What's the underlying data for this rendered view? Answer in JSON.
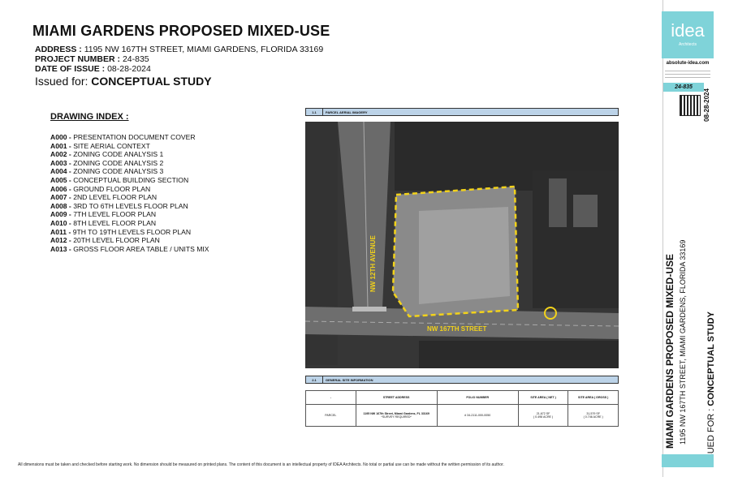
{
  "header": {
    "title": "MIAMI GARDENS PROPOSED MIXED-USE",
    "address_label": "ADDRESS :",
    "address": "1195 NW 167TH STREET, MIAMI GARDENS, FLORIDA 33169",
    "project_label": "PROJECT NUMBER :",
    "project": "24-835",
    "date_label": "DATE OF ISSUE :",
    "date": "08-28-2024",
    "issued_label": "Issued for:",
    "issued": "CONCEPTUAL STUDY"
  },
  "index": {
    "heading": "DRAWING INDEX :",
    "items": [
      {
        "code": "A000 -",
        "name": "PRESENTATION DOCUMENT COVER"
      },
      {
        "code": "A001 -",
        "name": "SITE AERIAL CONTEXT"
      },
      {
        "code": "A002 -",
        "name": "ZONING CODE ANALYSIS 1"
      },
      {
        "code": "A003 -",
        "name": "ZONING CODE ANALYSIS 2"
      },
      {
        "code": "A004 -",
        "name": "ZONING CODE ANALYSIS 3"
      },
      {
        "code": "A005 -",
        "name": "CONCEPTUAL BUILDING SECTION"
      },
      {
        "code": "A006 -",
        "name": "GROUND FLOOR PLAN"
      },
      {
        "code": "A007 -",
        "name": "2ND LEVEL FLOOR PLAN"
      },
      {
        "code": "A008 -",
        "name": "3RD TO 6TH LEVELS FLOOR PLAN"
      },
      {
        "code": "A009 -",
        "name": "7TH LEVEL FLOOR PLAN"
      },
      {
        "code": "A010 -",
        "name": "8TH LEVEL FLOOR PLAN"
      },
      {
        "code": "A011 -",
        "name": "9TH TO 19TH LEVELS FLOOR PLAN"
      },
      {
        "code": "A012 -",
        "name": "20TH LEVEL FLOOR PLAN"
      },
      {
        "code": "A013 -",
        "name": "GROSS FLOOR AREA TABLE / UNITS MIX"
      }
    ]
  },
  "aerial": {
    "bar_num": "1.1",
    "bar_title": "PARCEL AERIAL IMAGERY",
    "street_v": "NW 12TH AVENUE",
    "street_h": "NW 167TH STREET"
  },
  "siteinfo": {
    "bar_num": "2.1",
    "bar_title": "GENERAL SITE INFORMATION",
    "headers": [
      "-",
      "STREET ADDRESS",
      "FOLIO NUMBER",
      "SITE AREA ( NET )",
      "SITE AREA ( GROSS )"
    ],
    "row": {
      "name": "PARCEL",
      "address": "1195 NW 167th Street, Miami Gardens, FL 33169",
      "address_note": "*SURVEY REQUIRED*",
      "folio": "# 34-2111-000-0050",
      "net": "21,672 SF",
      "net_acre": "( 0.498 ACRE )",
      "gross": "31,579 SF",
      "gross_acre": "( 0.746 ACRE )"
    }
  },
  "footer": {
    "disclaimer": "All dimensions must be taken and checked before starting work. No dimension should be measured on printed plans. The content of this document is an intellectual property of IDEA Architects. No total or partial use can be made without the written permission of its author."
  },
  "sidebar": {
    "logo": "idea",
    "logo_sub": "Architects",
    "site": "absolute-idea.com",
    "project": "24-835",
    "date": "08-28-2024",
    "title": "MIAMI GARDENS PROPOSED MIXED-USE",
    "address": "1195 NW 167TH STREET, MIAMI GARDENS, FLORIDA 33169",
    "issued_label": "ISSUED FOR :",
    "issued": "CONCEPTUAL STUDY"
  },
  "colors": {
    "accent": "#7fd3d9",
    "bar": "#bcd3e8",
    "boundary": "#f2d21b"
  }
}
